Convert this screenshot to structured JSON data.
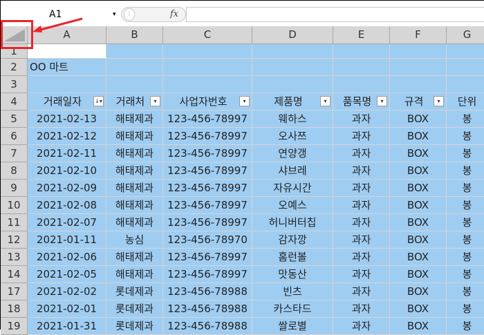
{
  "formula_bar": {
    "name_box": "A1",
    "fx_label": "fx",
    "dots": "⋮",
    "dropdown": "▾"
  },
  "columns": [
    "A",
    "B",
    "C",
    "D",
    "E",
    "F",
    "G"
  ],
  "rows": [
    {
      "num": "1",
      "cells": [
        "",
        "",
        "",
        "",
        "",
        "",
        ""
      ]
    },
    {
      "num": "2",
      "cells": [
        "OO 마트",
        "",
        "",
        "",
        "",
        "",
        ""
      ]
    },
    {
      "num": "3",
      "cells": [
        "",
        "",
        "",
        "",
        "",
        "",
        ""
      ]
    },
    {
      "num": "4",
      "cells": [
        "거래일자",
        "거래처",
        "사업자번호",
        "제품명",
        "품목명",
        "규격",
        "단위"
      ]
    },
    {
      "num": "5",
      "cells": [
        "2021-02-13",
        "해태제과",
        "123-456-78997",
        "웨하스",
        "과자",
        "BOX",
        "봉"
      ]
    },
    {
      "num": "6",
      "cells": [
        "2021-02-12",
        "해태제과",
        "123-456-78997",
        "오사쯔",
        "과자",
        "BOX",
        "봉"
      ]
    },
    {
      "num": "7",
      "cells": [
        "2021-02-11",
        "해태제과",
        "123-456-78997",
        "연양갱",
        "과자",
        "BOX",
        "봉"
      ]
    },
    {
      "num": "8",
      "cells": [
        "2021-02-10",
        "해태제과",
        "123-456-78997",
        "샤브레",
        "과자",
        "BOX",
        "봉"
      ]
    },
    {
      "num": "9",
      "cells": [
        "2021-02-09",
        "해태제과",
        "123-456-78997",
        "자유시간",
        "과자",
        "BOX",
        "봉"
      ]
    },
    {
      "num": "10",
      "cells": [
        "2021-02-08",
        "해태제과",
        "123-456-78997",
        "오예스",
        "과자",
        "BOX",
        "봉"
      ]
    },
    {
      "num": "11",
      "cells": [
        "2021-02-07",
        "해태제과",
        "123-456-78997",
        "허니버터칩",
        "과자",
        "BOX",
        "봉"
      ]
    },
    {
      "num": "12",
      "cells": [
        "2021-01-11",
        "농심",
        "123-456-78970",
        "감자깡",
        "과자",
        "BOX",
        "봉"
      ]
    },
    {
      "num": "13",
      "cells": [
        "2021-02-06",
        "해태제과",
        "123-456-78997",
        "홈런볼",
        "과자",
        "BOX",
        "봉"
      ]
    },
    {
      "num": "14",
      "cells": [
        "2021-02-05",
        "해태제과",
        "123-456-78997",
        "맛동산",
        "과자",
        "BOX",
        "봉"
      ]
    },
    {
      "num": "17",
      "cells": [
        "2021-02-02",
        "롯데제과",
        "123-456-78988",
        "빈츠",
        "과자",
        "BOX",
        "봉"
      ]
    },
    {
      "num": "18",
      "cells": [
        "2021-02-01",
        "롯데제과",
        "123-456-78988",
        "카스타드",
        "과자",
        "BOX",
        "봉"
      ]
    },
    {
      "num": "19",
      "cells": [
        "2021-01-31",
        "롯데제과",
        "123-456-78988",
        "쌀로별",
        "과자",
        "BOX",
        "봉"
      ]
    }
  ],
  "filter_buttons": {
    "sorted": "↓▾",
    "plain": "▾"
  },
  "colors": {
    "table_fill": "#9fcdf2",
    "highlight": "#e8262c",
    "header_gray": "#d6d6d6"
  }
}
